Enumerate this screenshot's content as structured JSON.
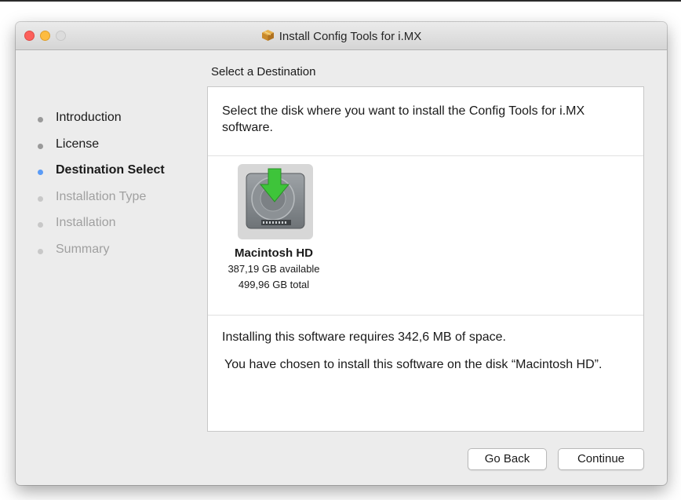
{
  "window": {
    "title": "Install Config Tools for i.MX"
  },
  "section_title": "Select a Destination",
  "steps": [
    {
      "label": "Introduction",
      "state": "done"
    },
    {
      "label": "License",
      "state": "done"
    },
    {
      "label": "Destination Select",
      "state": "current"
    },
    {
      "label": "Installation Type",
      "state": "future"
    },
    {
      "label": "Installation",
      "state": "future"
    },
    {
      "label": "Summary",
      "state": "future"
    }
  ],
  "content": {
    "intro": "Select the disk where you want to install the Config Tools for i.MX software.",
    "disk": {
      "name": "Macintosh HD",
      "available": "387,19 GB available",
      "total": "499,96 GB total",
      "icon": "hard-drive-download-icon"
    },
    "requirement": "Installing this software requires 342,6 MB of space.",
    "chosen": "You have chosen to install this software on the disk “Macintosh HD”."
  },
  "buttons": {
    "back": "Go Back",
    "continue": "Continue"
  },
  "colors": {
    "current_step_dot": "#5a9bf6",
    "close": "#fc605b",
    "minimize": "#fdbc40",
    "arrow": "#3ec43a"
  }
}
